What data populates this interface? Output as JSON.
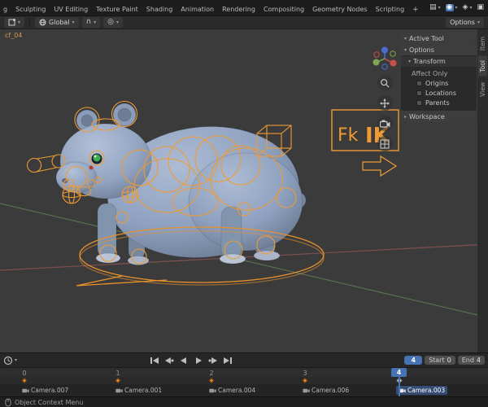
{
  "topbar": {
    "workspace_tabs": [
      {
        "label": "g"
      },
      {
        "label": "Sculpting"
      },
      {
        "label": "UV Editing"
      },
      {
        "label": "Texture Paint"
      },
      {
        "label": "Shading"
      },
      {
        "label": "Animation"
      },
      {
        "label": "Rendering"
      },
      {
        "label": "Compositing"
      },
      {
        "label": "Geometry Nodes"
      },
      {
        "label": "Scripting"
      }
    ],
    "add_tab_label": "+"
  },
  "viewport_header": {
    "orientation_label": "Global",
    "options_label": "Options"
  },
  "viewport": {
    "info_text": "cf_04",
    "bone_labels": {
      "fk": "Fk",
      "ik": "IK"
    }
  },
  "sidebar": {
    "tabs": [
      {
        "label": "Item",
        "active": false
      },
      {
        "label": "Tool",
        "active": true
      },
      {
        "label": "View",
        "active": false
      }
    ],
    "active_tool_label": "Active Tool",
    "options_label": "Options",
    "transform_label": "Transform",
    "affect_only_label": "Affect Only",
    "checkboxes": [
      {
        "label": "Origins",
        "checked": false
      },
      {
        "label": "Locations",
        "checked": false
      },
      {
        "label": "Parents",
        "checked": false
      }
    ],
    "workspace_label": "Workspace"
  },
  "timeline": {
    "current_frame": "4",
    "start_label": "Start",
    "start_value": "0",
    "end_label": "End",
    "end_value": "4",
    "frames": [
      "0",
      "1",
      "2",
      "3"
    ],
    "markers": [
      {
        "name": "Camera.007",
        "frame": 0,
        "selected": false
      },
      {
        "name": "Camera.001",
        "frame": 1,
        "selected": false
      },
      {
        "name": "Camera.004",
        "frame": 2,
        "selected": false
      },
      {
        "name": "Camera.006",
        "frame": 3,
        "selected": false
      },
      {
        "name": "Camera.003",
        "frame": 4,
        "selected": true
      }
    ]
  },
  "statusbar": {
    "context_text": "Object Context Menu"
  },
  "colors": {
    "rig_orange": "#ef9b35",
    "selection_blue": "#4772b3",
    "model_blue": "#8ea1bf"
  }
}
